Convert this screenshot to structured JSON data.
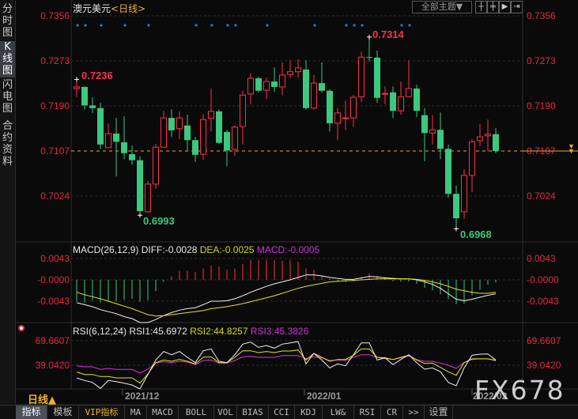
{
  "sidebar": {
    "tabs": [
      {
        "label": "分时图",
        "active": false
      },
      {
        "label": "K线图",
        "active": true
      },
      {
        "label": "闪电图",
        "active": false
      },
      {
        "label": "合约资料",
        "active": false
      }
    ]
  },
  "header": {
    "symbol": "澳元美元",
    "period": "<日线>",
    "theme_button": "全部主题▼",
    "tools": [
      "crosshair-icon",
      "zoom-range-icon",
      "play-icon",
      "move-right-icon"
    ]
  },
  "colors": {
    "up": "#ff3048",
    "down": "#3cc87e",
    "axis_text": "#e8283c",
    "last_price_line": "#f0a040",
    "event_dot": "#1e7fd0",
    "diff": "#f0f0f0",
    "dea": "#e8e800",
    "rsi1": "#f0f0f0",
    "rsi2": "#e8e800",
    "rsi3": "#e030e8"
  },
  "price_axis": {
    "labels": [
      "0.7356",
      "0.7273",
      "0.7190",
      "0.7107",
      "0.7024"
    ],
    "last_price": "0.7107"
  },
  "annotations": {
    "high1": "0.7236",
    "low1": "0.6993",
    "high2": "0.7314",
    "low2": "0.6968"
  },
  "macd": {
    "legend_name": "MACD(26,12,9)",
    "diff_label": "DIFF:-0.0028",
    "dea_label": "DEA:-0.0025",
    "macd_label": "MACD:-0.0005",
    "axis_labels": [
      "0.0043",
      "-0.0000",
      "-0.0043"
    ]
  },
  "rsi": {
    "legend_name": "RSI(6,12,24)",
    "rsi1_label": "RSI1:45.6972",
    "rsi2_label": "RSI2:44.8257",
    "rsi3_label": "RSI3:45.3826",
    "axis_labels": [
      "69.6607",
      "39.0420"
    ]
  },
  "date_axis": {
    "period_label": "日线▲",
    "dates": [
      "2021/12",
      "2022/01",
      "2022/02"
    ]
  },
  "watermark": "FX678",
  "toolbar": {
    "tabs": [
      "指标",
      "模板",
      "VIP指标",
      "MA",
      "MACD",
      "BOLL",
      "VOL",
      "BIAS",
      "CCI",
      "KDJ",
      "LW&",
      "RSI",
      "CR",
      ">>",
      "设置"
    ]
  },
  "chart_data": {
    "type": "candlestick",
    "title": "澳元美元 <日线>",
    "ylim": [
      0.694,
      0.7385
    ],
    "event_marker_candles": [
      1,
      2,
      4,
      7,
      10,
      16,
      18,
      20,
      21,
      25,
      31,
      35,
      36,
      37,
      42,
      43
    ],
    "ohlc": [
      [
        0.7222,
        0.7236,
        0.7206,
        0.7225
      ],
      [
        0.7225,
        0.7226,
        0.7183,
        0.7191
      ],
      [
        0.7191,
        0.7206,
        0.7177,
        0.7186
      ],
      [
        0.7186,
        0.7196,
        0.7111,
        0.7119
      ],
      [
        0.7113,
        0.7158,
        0.7113,
        0.7139
      ],
      [
        0.7139,
        0.7168,
        0.706,
        0.7124
      ],
      [
        0.7123,
        0.7171,
        0.7092,
        0.7103
      ],
      [
        0.7101,
        0.7117,
        0.7082,
        0.709
      ],
      [
        0.709,
        0.7097,
        0.6993,
        0.6996
      ],
      [
        0.6995,
        0.7052,
        0.6994,
        0.7046
      ],
      [
        0.7046,
        0.712,
        0.7037,
        0.7114
      ],
      [
        0.7114,
        0.7181,
        0.7113,
        0.7168
      ],
      [
        0.7168,
        0.7184,
        0.7133,
        0.7145
      ],
      [
        0.7148,
        0.718,
        0.7129,
        0.7168
      ],
      [
        0.7154,
        0.7174,
        0.7108,
        0.7127
      ],
      [
        0.7127,
        0.7133,
        0.7087,
        0.71
      ],
      [
        0.7101,
        0.7175,
        0.709,
        0.7165
      ],
      [
        0.7167,
        0.7222,
        0.7143,
        0.718
      ],
      [
        0.718,
        0.7183,
        0.712,
        0.7122
      ],
      [
        0.7142,
        0.7146,
        0.7079,
        0.7108
      ],
      [
        0.711,
        0.7154,
        0.7098,
        0.7151
      ],
      [
        0.7152,
        0.7218,
        0.7119,
        0.721
      ],
      [
        0.7212,
        0.725,
        0.7193,
        0.7241
      ],
      [
        0.7241,
        0.7244,
        0.7215,
        0.7218
      ],
      [
        0.7219,
        0.7242,
        0.7203,
        0.7235
      ],
      [
        0.7235,
        0.7261,
        0.7216,
        0.7225
      ],
      [
        0.7225,
        0.727,
        0.721,
        0.7247
      ],
      [
        0.7248,
        0.7274,
        0.7242,
        0.7253
      ],
      [
        0.7253,
        0.7276,
        0.7242,
        0.726
      ],
      [
        0.7257,
        0.7274,
        0.7183,
        0.7186
      ],
      [
        0.7186,
        0.7247,
        0.7183,
        0.7232
      ],
      [
        0.7232,
        0.727,
        0.7215,
        0.7218
      ],
      [
        0.7218,
        0.7221,
        0.7143,
        0.7158
      ],
      [
        0.7158,
        0.7186,
        0.7127,
        0.7177
      ],
      [
        0.7167,
        0.72,
        0.7146,
        0.7168
      ],
      [
        0.7168,
        0.721,
        0.7152,
        0.7206
      ],
      [
        0.7207,
        0.729,
        0.7197,
        0.728
      ],
      [
        0.728,
        0.7314,
        0.7272,
        0.7279
      ],
      [
        0.7279,
        0.7292,
        0.7196,
        0.7205
      ],
      [
        0.7212,
        0.7226,
        0.7193,
        0.7213
      ],
      [
        0.7215,
        0.7226,
        0.7168,
        0.7181
      ],
      [
        0.7181,
        0.7235,
        0.7174,
        0.7207
      ],
      [
        0.7207,
        0.7274,
        0.7206,
        0.7222
      ],
      [
        0.7222,
        0.7229,
        0.717,
        0.7181
      ],
      [
        0.7173,
        0.7186,
        0.7088,
        0.714
      ],
      [
        0.714,
        0.7173,
        0.7119,
        0.7146
      ],
      [
        0.7146,
        0.7178,
        0.7092,
        0.7111
      ],
      [
        0.7111,
        0.7119,
        0.7021,
        0.7028
      ],
      [
        0.7028,
        0.7043,
        0.6968,
        0.6983
      ],
      [
        0.6995,
        0.7073,
        0.6982,
        0.7062
      ],
      [
        0.7062,
        0.7129,
        0.7031,
        0.7124
      ],
      [
        0.7126,
        0.7157,
        0.7116,
        0.7133
      ],
      [
        0.7135,
        0.7165,
        0.7107,
        0.7138
      ],
      [
        0.7138,
        0.7149,
        0.7103,
        0.7107
      ]
    ],
    "macd_hist": [
      -0.0043,
      -0.0046,
      -0.0042,
      -0.0046,
      -0.0044,
      -0.0043,
      -0.004,
      -0.0038,
      -0.0044,
      -0.0041,
      -0.0023,
      -0.0004,
      0.0007,
      0.0018,
      0.0018,
      0.0016,
      0.0023,
      0.0029,
      0.0027,
      0.0021,
      0.0023,
      0.0032,
      0.004,
      0.004,
      0.004,
      0.004,
      0.0039,
      0.004,
      0.0037,
      0.0023,
      0.002,
      0.0008,
      0.0003,
      -0.0002,
      -0.0004,
      -0.0003,
      0.0006,
      0.0013,
      0.0008,
      0.0005,
      -0.0003,
      -0.0004,
      -0.0003,
      -0.0008,
      -0.0016,
      -0.0021,
      -0.0029,
      -0.0039,
      -0.0049,
      -0.0048,
      -0.0031,
      -0.002,
      -0.001,
      -0.0005
    ],
    "diff": [
      -0.0046,
      -0.005,
      -0.0054,
      -0.006,
      -0.0064,
      -0.0068,
      -0.0074,
      -0.0078,
      -0.0086,
      -0.0086,
      -0.008,
      -0.0072,
      -0.0066,
      -0.0061,
      -0.0058,
      -0.0056,
      -0.005,
      -0.0043,
      -0.0043,
      -0.0042,
      -0.0038,
      -0.0032,
      -0.0025,
      -0.0019,
      -0.0013,
      -0.0008,
      -0.0004,
      0.0,
      0.0005,
      0.001,
      0.001,
      0.0008,
      0.0005,
      0.0003,
      0.0001,
      0.0001,
      0.0004,
      0.0007,
      0.0006,
      0.0004,
      0.0003,
      0.0002,
      0.0002,
      0.0,
      -0.0004,
      -0.0009,
      -0.0017,
      -0.0028,
      -0.0039,
      -0.0042,
      -0.0039,
      -0.0035,
      -0.0031,
      -0.0028
    ],
    "dea": [
      -0.0025,
      -0.003,
      -0.0034,
      -0.0038,
      -0.0043,
      -0.0048,
      -0.0053,
      -0.0058,
      -0.0064,
      -0.007,
      -0.0073,
      -0.0072,
      -0.007,
      -0.0068,
      -0.0066,
      -0.0064,
      -0.0062,
      -0.0058,
      -0.0056,
      -0.0054,
      -0.0051,
      -0.0048,
      -0.0044,
      -0.004,
      -0.0036,
      -0.0032,
      -0.0027,
      -0.0022,
      -0.0017,
      -0.0013,
      -0.001,
      -0.0007,
      -0.0004,
      -0.0003,
      -0.0002,
      -0.0001,
      0.0,
      0.0001,
      0.0002,
      0.0002,
      0.0002,
      0.0002,
      0.0002,
      0.0001,
      -0.0001,
      -0.0004,
      -0.0008,
      -0.0013,
      -0.0019,
      -0.0022,
      -0.0025,
      -0.0027,
      -0.0027,
      -0.0025
    ],
    "rsi1": [
      23.2,
      20.0,
      17.6,
      10.1,
      20.0,
      18.6,
      16.7,
      14.4,
      9.4,
      27.5,
      45.6,
      56.2,
      52.2,
      56.2,
      48.9,
      42.3,
      57.1,
      59.4,
      44.0,
      42.3,
      52.2,
      65.4,
      68.0,
      61.4,
      63.7,
      60.4,
      65.4,
      67.0,
      68.7,
      40.7,
      53.9,
      45.6,
      35.7,
      40.7,
      38.4,
      52.2,
      67.0,
      67.0,
      45.6,
      48.3,
      39.7,
      46.3,
      52.2,
      42.3,
      34.1,
      35.7,
      30.8,
      17.6,
      13.4,
      35.7,
      51.5,
      52.9,
      53.2,
      45.7
    ],
    "rsi2": [
      30.5,
      27.5,
      27.5,
      24.9,
      24.9,
      23.2,
      23.2,
      23.2,
      16.7,
      28.0,
      42.3,
      45.6,
      44.0,
      46.3,
      44.0,
      40.7,
      48.9,
      49.6,
      42.3,
      42.3,
      48.9,
      57.1,
      57.1,
      54.8,
      56.2,
      54.8,
      56.8,
      56.8,
      58.1,
      45.6,
      53.9,
      48.9,
      44.0,
      46.3,
      46.3,
      51.5,
      59.4,
      59.4,
      48.9,
      48.3,
      46.3,
      48.9,
      51.5,
      45.6,
      41.3,
      41.7,
      36.4,
      30.8,
      26.5,
      42.3,
      47.0,
      47.0,
      47.0,
      44.8
    ],
    "rsi3": [
      38.4,
      37.1,
      37.1,
      33.8,
      35.1,
      33.8,
      33.8,
      33.8,
      29.2,
      34.1,
      41.7,
      43.6,
      42.3,
      44.0,
      43.0,
      39.7,
      45.0,
      45.6,
      41.7,
      41.7,
      45.0,
      49.6,
      50.2,
      48.9,
      48.9,
      48.9,
      51.2,
      51.2,
      51.2,
      47.3,
      49.6,
      48.3,
      45.0,
      45.6,
      45.0,
      48.9,
      52.2,
      52.2,
      48.9,
      47.3,
      46.3,
      48.3,
      50.6,
      46.3,
      44.0,
      44.0,
      41.7,
      39.0,
      35.1,
      42.3,
      46.3,
      47.0,
      47.0,
      45.4
    ]
  }
}
